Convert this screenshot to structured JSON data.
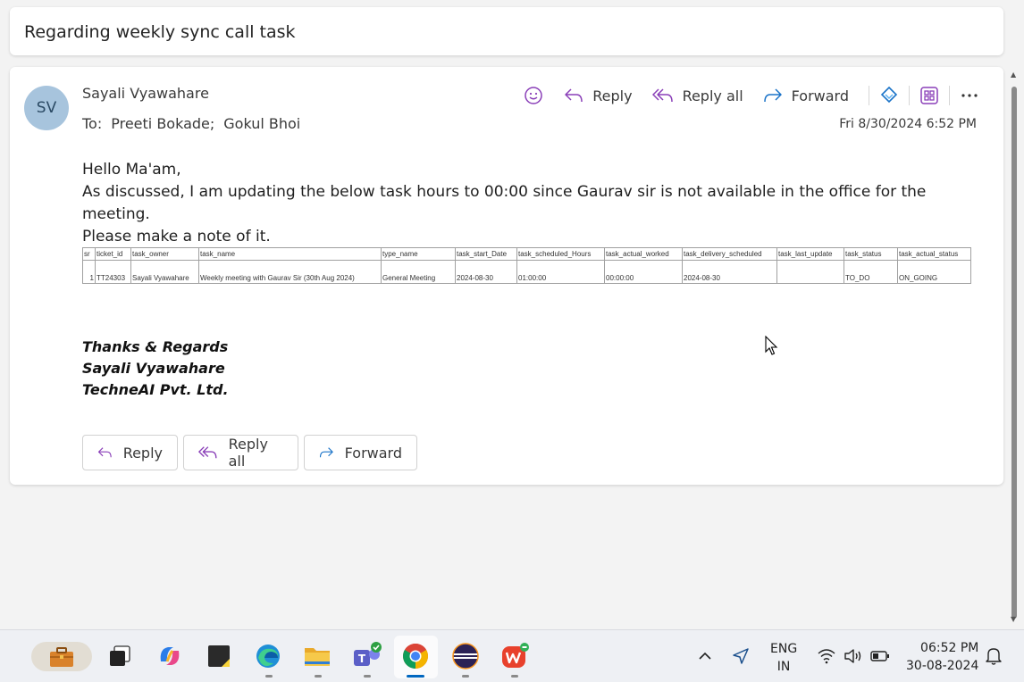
{
  "subject": "Regarding weekly sync call task",
  "message": {
    "avatar_initials": "SV",
    "sender": "Sayali Vyawahare",
    "to_label": "To:",
    "recipients": [
      "Preeti Bokade;",
      "Gokul Bhoi"
    ],
    "date": "Fri 8/30/2024 6:52 PM",
    "actions": {
      "reply": "Reply",
      "reply_all": "Reply all",
      "forward": "Forward"
    },
    "body": {
      "greeting": "Hello Ma'am,",
      "line1": "As discussed, I am updating the below task hours to 00:00 since Gaurav sir is not available in the office for the meeting.",
      "line2": "Please make a note of it."
    },
    "table": {
      "headers": [
        "sr",
        "ticket_id",
        "task_owner",
        "task_name",
        "type_name",
        "task_start_Date",
        "task_scheduled_Hours",
        "task_actual_worked",
        "task_delivery_scheduled",
        "task_last_update",
        "task_status",
        "task_actual_status"
      ],
      "rows": [
        [
          "1",
          "TT24303",
          "Sayali Vyawahare",
          "Weekly meeting with Gaurav Sir (30th Aug 2024)",
          "General Meeting",
          "2024-08-30",
          "01:00:00",
          "00:00:00",
          "2024-08-30",
          "",
          "TO_DO",
          "ON_GOING"
        ]
      ]
    },
    "signature": {
      "line1": "Thanks & Regards",
      "line2": "Sayali Vyawahare",
      "line3": "TechneAI Pvt. Ltd."
    }
  },
  "taskbar": {
    "lang_line1": "ENG",
    "lang_line2": "IN",
    "time": "06:52 PM",
    "date": "30-08-2024"
  },
  "colors": {
    "accent_purple": "#8a3fb8",
    "avatar_bg": "#a7c4dd",
    "forward_blue": "#1a73c8"
  }
}
